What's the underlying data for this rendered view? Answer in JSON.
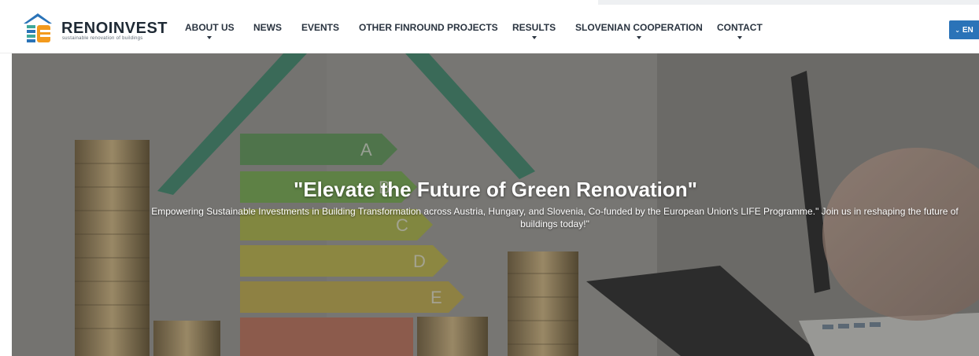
{
  "brand": {
    "name": "RENOINVEST",
    "tagline": "sustainable renovation of buildings"
  },
  "nav": {
    "items": [
      {
        "label": "ABOUT US",
        "has_dropdown": true
      },
      {
        "label": "NEWS",
        "has_dropdown": false
      },
      {
        "label": "EVENTS",
        "has_dropdown": false
      },
      {
        "label": "OTHER FINROUND PROJECTS",
        "has_dropdown": false
      },
      {
        "label": "RESULTS",
        "has_dropdown": true
      },
      {
        "label": "SLOVENIAN COOPERATION",
        "has_dropdown": true
      },
      {
        "label": "CONTACT",
        "has_dropdown": true
      }
    ]
  },
  "language": {
    "label": "EN",
    "icon": "chevron-down-icon"
  },
  "hero": {
    "title": "\"Elevate the Future of Green Renovation\"",
    "text": "Empowering Sustainable Investments in Building Transformation across Austria, Hungary, and Slovenia, Co-funded by the European Union's LIFE Programme.\" Join us in reshaping the future of buildings today!\"",
    "energy_labels": [
      "A",
      "B",
      "C",
      "D",
      "E"
    ]
  },
  "colors": {
    "accent": "#2a73b8",
    "logo_orange": "#f39a1d",
    "logo_blue": "#2a73b8",
    "logo_teal": "#3fa89a",
    "nav_text": "#2a3440"
  }
}
